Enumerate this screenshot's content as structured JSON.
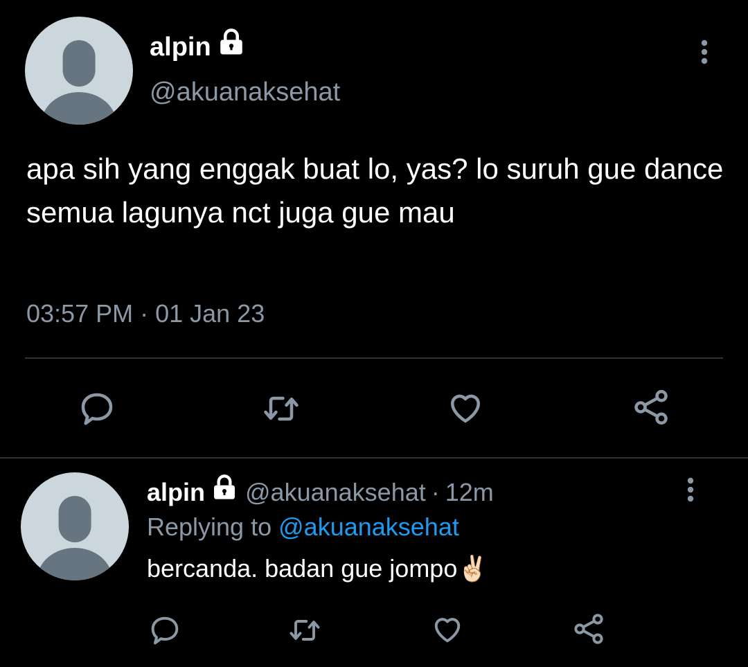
{
  "main_tweet": {
    "display_name": "alpin",
    "handle": "@akuanaksehat",
    "text": "apa sih yang enggak buat lo, yas? lo suruh gue dance semua lagunya nct juga gue mau",
    "timestamp": "03:57 PM · 01 Jan 23",
    "actions": [
      {
        "icon": "reply-icon"
      },
      {
        "icon": "retweet-icon"
      },
      {
        "icon": "like-icon"
      },
      {
        "icon": "share-icon"
      }
    ]
  },
  "reply_tweet": {
    "display_name": "alpin",
    "handle": "@akuanaksehat",
    "separator": "·",
    "time_ago": "12m",
    "replying_label": "Replying to",
    "replying_to": "@akuanaksehat",
    "text": "bercanda. badan gue jompo",
    "emoji": "✌🏻",
    "actions": [
      {
        "icon": "reply-icon"
      },
      {
        "icon": "retweet-icon"
      },
      {
        "icon": "like-icon"
      },
      {
        "icon": "share-icon"
      }
    ]
  },
  "icons": {
    "lock": "lock-icon",
    "more": "more-vertical-icon"
  },
  "colors": {
    "background": "#000000",
    "text_primary": "#ffffff",
    "text_secondary": "#8b98a5",
    "link": "#1d9bf0",
    "divider": "#2f3336",
    "avatar_bg": "#ccd6dd",
    "avatar_fg": "#66757f"
  }
}
